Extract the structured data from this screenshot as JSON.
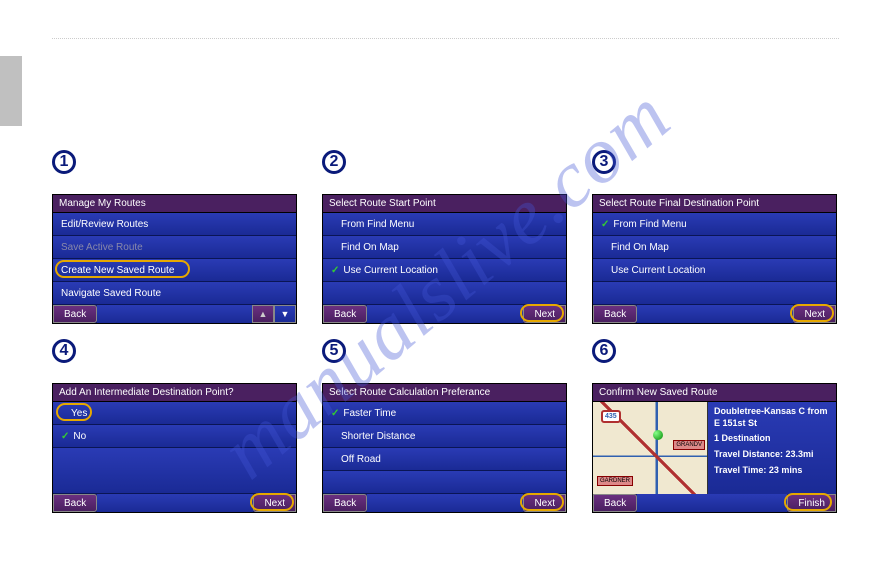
{
  "watermark": "manualslive.com",
  "steps": [
    {
      "num": "1",
      "title": "Manage My Routes",
      "items": [
        {
          "label": "Edit/Review Routes",
          "disabled": false,
          "check": false
        },
        {
          "label": "Save Active Route",
          "disabled": true,
          "check": false
        },
        {
          "label": "Create New Saved Route",
          "disabled": false,
          "check": false,
          "highlight": true
        },
        {
          "label": "Navigate Saved Route",
          "disabled": false,
          "check": false
        }
      ],
      "footer": {
        "back": "Back",
        "arrows": true
      }
    },
    {
      "num": "2",
      "title": "Select Route Start Point",
      "items": [
        {
          "label": "From Find Menu",
          "check": false,
          "indent": true
        },
        {
          "label": "Find On Map",
          "check": false,
          "indent": true
        },
        {
          "label": "Use Current Location",
          "check": true
        }
      ],
      "filler": 1,
      "footer": {
        "back": "Back",
        "next": "Next",
        "highlight_next": true
      }
    },
    {
      "num": "3",
      "title": "Select Route Final Destination Point",
      "items": [
        {
          "label": "From Find Menu",
          "check": true
        },
        {
          "label": "Find On Map",
          "check": false,
          "indent": true
        },
        {
          "label": "Use Current Location",
          "check": false,
          "indent": true
        }
      ],
      "filler": 1,
      "footer": {
        "back": "Back",
        "next": "Next",
        "highlight_next": true
      }
    },
    {
      "num": "4",
      "title": "Add An Intermediate Destination Point?",
      "items": [
        {
          "label": "Yes",
          "check": false,
          "highlight": true,
          "indent": true
        },
        {
          "label": "No",
          "check": true
        }
      ],
      "filler": 2,
      "footer": {
        "back": "Back",
        "next": "Next",
        "highlight_next": true
      }
    },
    {
      "num": "5",
      "title": "Select Route Calculation Preferance",
      "items": [
        {
          "label": "Faster Time",
          "check": true
        },
        {
          "label": "Shorter Distance",
          "check": false,
          "indent": true
        },
        {
          "label": "Off Road",
          "check": false,
          "indent": true
        }
      ],
      "filler": 1,
      "footer": {
        "back": "Back",
        "next": "Next",
        "highlight_next": true
      }
    },
    {
      "num": "6",
      "title": "Confirm New Saved Route",
      "confirm": {
        "route_name": "Doubletree-Kansas C from E 151st St",
        "dest_count": "1 Destination",
        "distance": "Travel Distance: 23.3mi",
        "time": "Travel Time: 23 mins",
        "shield": "435",
        "label1": "GARDNER",
        "label2": "GRANDV"
      },
      "footer": {
        "back": "Back",
        "next": "Finish",
        "highlight_next": true
      }
    }
  ]
}
